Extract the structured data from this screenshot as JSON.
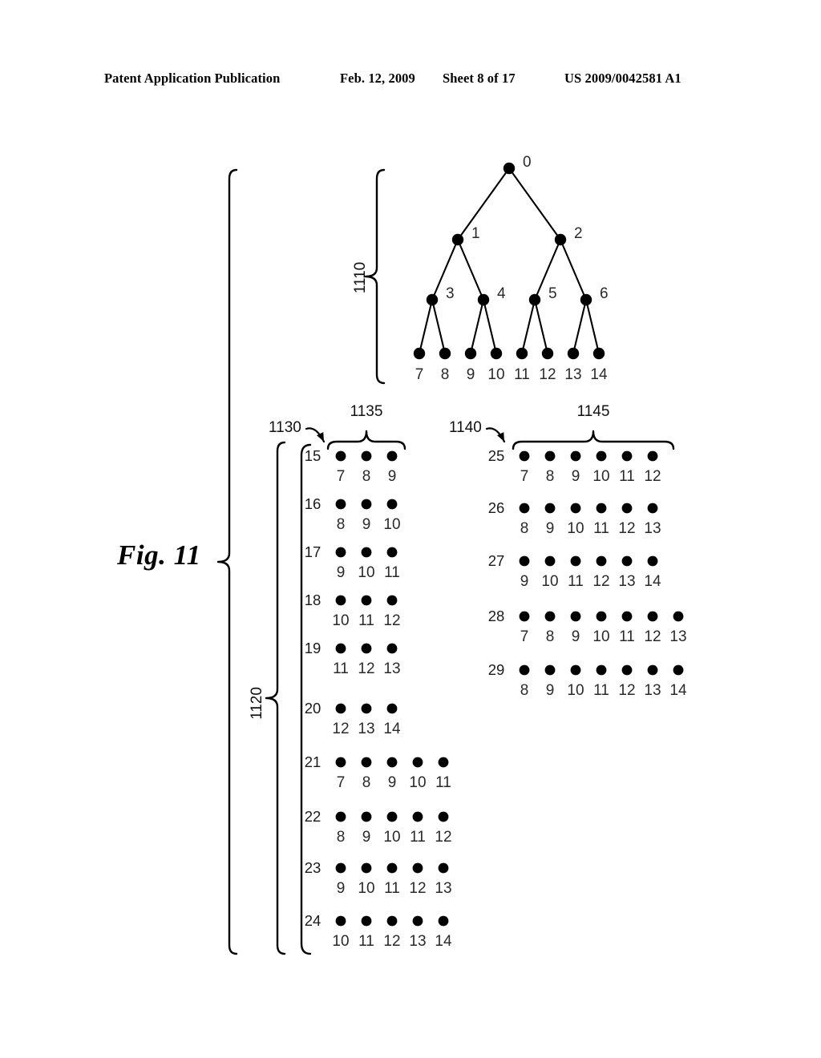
{
  "header": {
    "publication": "Patent Application Publication",
    "date": "Feb. 12, 2009",
    "sheet": "Sheet 8 of 17",
    "patent_number": "US 2009/0042581 A1"
  },
  "figure": {
    "caption": "Fig. 11",
    "reference_numerals": {
      "tree": "1110",
      "lists_group": "1120",
      "left_list_group": "1130",
      "left_list_columns": "1135",
      "right_list_group": "1140",
      "right_list_columns": "1145"
    },
    "tree": {
      "description": "complete binary tree, nodes 0-14",
      "levels": [
        {
          "labels": [
            "0"
          ]
        },
        {
          "labels": [
            "1",
            "2"
          ]
        },
        {
          "labels": [
            "3",
            "4",
            "5",
            "6"
          ]
        },
        {
          "labels": [
            "7",
            "8",
            "9",
            "10",
            "11",
            "12",
            "13",
            "14"
          ]
        }
      ],
      "edges": [
        [
          "0",
          "1"
        ],
        [
          "0",
          "2"
        ],
        [
          "1",
          "3"
        ],
        [
          "1",
          "4"
        ],
        [
          "2",
          "5"
        ],
        [
          "2",
          "6"
        ],
        [
          "3",
          "7"
        ],
        [
          "3",
          "8"
        ],
        [
          "4",
          "9"
        ],
        [
          "4",
          "10"
        ],
        [
          "5",
          "11"
        ],
        [
          "5",
          "12"
        ],
        [
          "6",
          "13"
        ],
        [
          "6",
          "14"
        ]
      ]
    },
    "left_rows": [
      {
        "index": "15",
        "values": [
          "7",
          "8",
          "9"
        ]
      },
      {
        "index": "16",
        "values": [
          "8",
          "9",
          "10"
        ]
      },
      {
        "index": "17",
        "values": [
          "9",
          "10",
          "11"
        ]
      },
      {
        "index": "18",
        "values": [
          "10",
          "11",
          "12"
        ]
      },
      {
        "index": "19",
        "values": [
          "11",
          "12",
          "13"
        ]
      },
      {
        "index": "20",
        "values": [
          "12",
          "13",
          "14"
        ]
      },
      {
        "index": "21",
        "values": [
          "7",
          "8",
          "9",
          "10",
          "11"
        ]
      },
      {
        "index": "22",
        "values": [
          "8",
          "9",
          "10",
          "11",
          "12"
        ]
      },
      {
        "index": "23",
        "values": [
          "9",
          "10",
          "11",
          "12",
          "13"
        ]
      },
      {
        "index": "24",
        "values": [
          "10",
          "11",
          "12",
          "13",
          "14"
        ]
      }
    ],
    "right_rows": [
      {
        "index": "25",
        "values": [
          "7",
          "8",
          "9",
          "10",
          "11",
          "12"
        ]
      },
      {
        "index": "26",
        "values": [
          "8",
          "9",
          "10",
          "11",
          "12",
          "13"
        ]
      },
      {
        "index": "27",
        "values": [
          "9",
          "10",
          "11",
          "12",
          "13",
          "14"
        ]
      },
      {
        "index": "28",
        "values": [
          "7",
          "8",
          "9",
          "10",
          "11",
          "12",
          "13"
        ]
      },
      {
        "index": "29",
        "values": [
          "8",
          "9",
          "10",
          "11",
          "12",
          "13",
          "14"
        ]
      }
    ],
    "colors": {
      "ink": "#000000",
      "paper": "#ffffff",
      "label": "#1a1a1a"
    }
  }
}
